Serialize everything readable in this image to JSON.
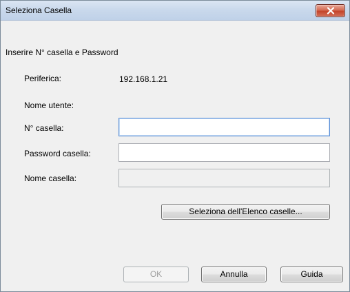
{
  "window": {
    "title": "Seleziona Casella"
  },
  "form": {
    "heading": "Inserire N° casella e Password",
    "device_label": "Periferica:",
    "device_value": "192.168.1.21",
    "username_label": "Nome utente:",
    "username_value": "",
    "box_number_label": "N° casella:",
    "box_number_value": "",
    "box_password_label": "Password casella:",
    "box_password_value": "",
    "box_name_label": "Nome casella:",
    "box_name_value": ""
  },
  "buttons": {
    "select_from_list": "Seleziona dell'Elenco caselle...",
    "ok": "OK",
    "cancel": "Annulla",
    "help": "Guida"
  },
  "colors": {
    "close_button": "#c4432a",
    "focus_border": "#5c8fd6"
  },
  "icons": {
    "close": "close-icon"
  }
}
